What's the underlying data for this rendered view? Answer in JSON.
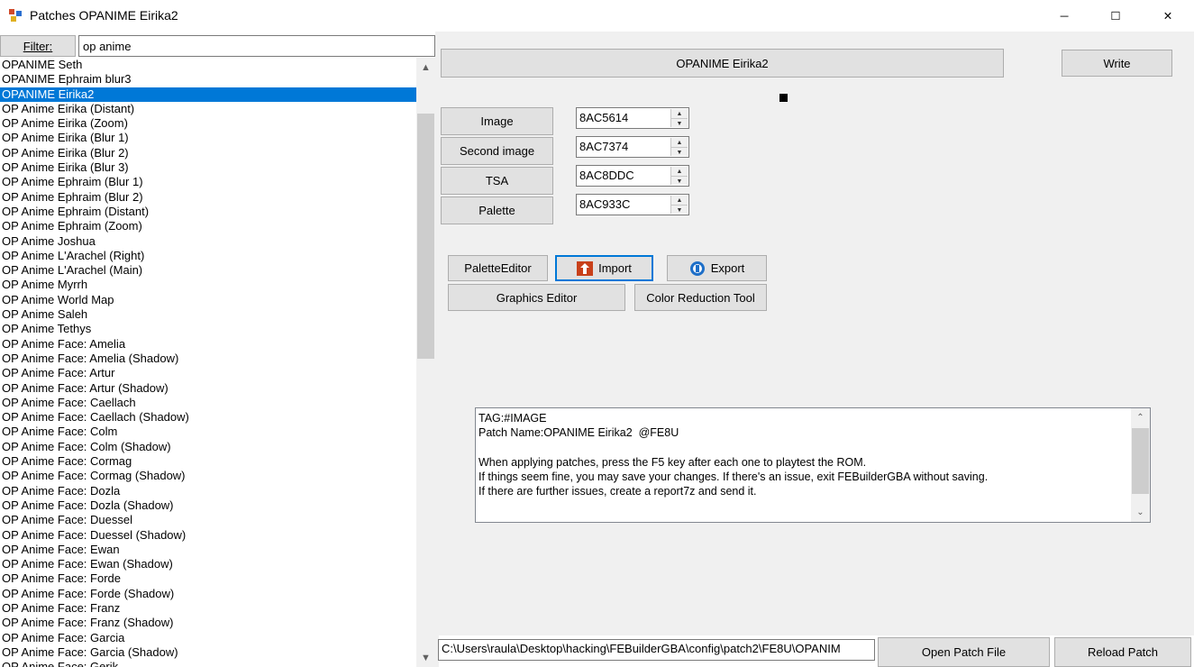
{
  "window": {
    "title": "Patches OPANIME Eirika2",
    "minimize_glyph": "─",
    "maximize_glyph": "☐",
    "close_glyph": "✕"
  },
  "filter": {
    "label": "Filter:",
    "value": "op anime"
  },
  "patch_list": {
    "items": [
      "OPANIME Seth",
      "OPANIME Ephraim blur3",
      "OPANIME Eirika2",
      "OP Anime Eirika (Distant)",
      "OP Anime Eirika (Zoom)",
      "OP Anime Eirika (Blur 1)",
      "OP Anime Eirika (Blur 2)",
      "OP Anime Eirika (Blur 3)",
      "OP Anime Ephraim (Blur 1)",
      "OP Anime Ephraim (Blur 2)",
      "OP Anime Ephraim (Distant)",
      "OP Anime Ephraim (Zoom)",
      "OP Anime Joshua",
      "OP Anime L'Arachel (Right)",
      "OP Anime L'Arachel (Main)",
      "OP Anime Myrrh",
      "OP Anime World Map",
      "OP Anime Saleh",
      "OP Anime Tethys",
      "OP Anime Face: Amelia",
      "OP Anime Face: Amelia (Shadow)",
      "OP Anime Face: Artur",
      "OP Anime Face: Artur (Shadow)",
      "OP Anime Face: Caellach",
      "OP Anime Face: Caellach (Shadow)",
      "OP Anime Face: Colm",
      "OP Anime Face: Colm (Shadow)",
      "OP Anime Face: Cormag",
      "OP Anime Face: Cormag (Shadow)",
      "OP Anime Face: Dozla",
      "OP Anime Face: Dozla (Shadow)",
      "OP Anime Face: Duessel",
      "OP Anime Face: Duessel (Shadow)",
      "OP Anime Face: Ewan",
      "OP Anime Face: Ewan (Shadow)",
      "OP Anime Face: Forde",
      "OP Anime Face: Forde (Shadow)",
      "OP Anime Face: Franz",
      "OP Anime Face: Franz (Shadow)",
      "OP Anime Face: Garcia",
      "OP Anime Face: Garcia (Shadow)",
      "OP Anime Face: Gerik"
    ],
    "selected_index": 2
  },
  "patch_panel": {
    "name": "OPANIME Eirika2",
    "write_label": "Write",
    "fields": [
      {
        "label": "Image",
        "value": "8AC5614"
      },
      {
        "label": "Second image",
        "value": "8AC7374"
      },
      {
        "label": "TSA",
        "value": "8AC8DDC"
      },
      {
        "label": "Palette",
        "value": "8AC933C"
      }
    ],
    "palette_editor_label": "PaletteEditor",
    "import_label": "Import",
    "export_label": "Export",
    "graphics_editor_label": "Graphics Editor",
    "color_reduction_label": "Color Reduction Tool",
    "info_text": "TAG:#IMAGE\nPatch Name:OPANIME Eirika2  @FE8U\n\nWhen applying patches, press the F5 key after each one to playtest the ROM.\nIf things seem fine, you may save your changes. If there's an issue, exit FEBuilderGBA without saving.\nIf there are further issues, create a report7z and send it."
  },
  "bottom": {
    "path": "C:\\Users\\raula\\Desktop\\hacking\\FEBuilderGBA\\config\\patch2\\FE8U\\OPANIM",
    "open_patch_label": "Open Patch File",
    "reload_patch_label": "Reload Patch"
  },
  "colors": {
    "selection": "#0078d7",
    "panel_bg": "#f0f0f0",
    "button_bg": "#e1e1e1",
    "import_icon": "#c8401a",
    "export_icon": "#1e6fc8"
  }
}
